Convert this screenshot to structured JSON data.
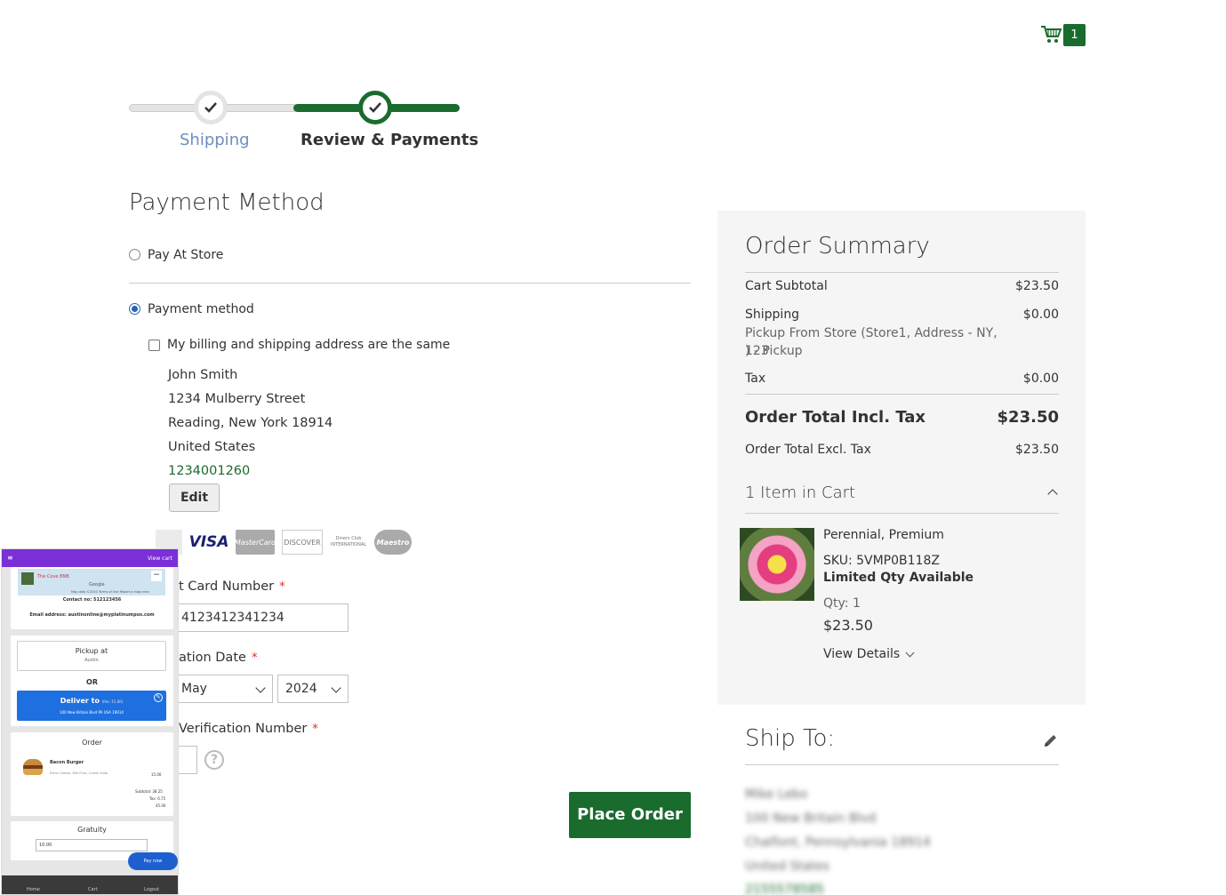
{
  "header": {
    "cart_count": "1"
  },
  "progress": {
    "steps": [
      {
        "label": "Shipping",
        "state": "complete"
      },
      {
        "label": "Review & Payments",
        "state": "active"
      }
    ]
  },
  "payment": {
    "title": "Payment Method",
    "options": [
      {
        "label": "Pay At Store",
        "selected": false
      },
      {
        "label": "Payment method",
        "selected": true
      }
    ],
    "same_address_label": "My billing and shipping address are the same",
    "address": {
      "name": "John Smith",
      "street": "1234 Mulberry Street",
      "city": "Reading, New York 18914",
      "country": "United States",
      "phone": "1234001260"
    },
    "edit_label": "Edit",
    "card_logos": [
      "VISA",
      "MasterCard",
      "DISCOVER",
      "Diners Club INTERNATIONAL",
      "Maestro"
    ],
    "card_number_label": "t Card Number",
    "card_number_value": "4123412341234",
    "expiration_label": "ation Date",
    "exp_month": "May",
    "exp_year": "2024",
    "cvv_label": "Verification Number",
    "required_mark": "*",
    "place_order": "Place Order"
  },
  "summary": {
    "title": "Order Summary",
    "cart_subtotal_label": "Cart Subtotal",
    "cart_subtotal_value": "$23.50",
    "shipping_label": "Shipping",
    "shipping_value": "$0.00",
    "shipping_method_line1": "Pickup From Store (Store1, Address - NY, 123",
    "shipping_method_line2": ") - Pickup",
    "tax_label": "Tax",
    "tax_value": "$0.00",
    "total_incl_label": "Order Total Incl. Tax",
    "total_incl_value": "$23.50",
    "total_excl_label": "Order Total Excl. Tax",
    "total_excl_value": "$23.50",
    "items_in_cart": "1 Item in Cart",
    "item": {
      "name": "Perennial, Premium",
      "sku": "SKU: 5VMP0B118Z",
      "stock": "Limited Qty Available",
      "qty": "Qty: 1",
      "price": "$23.50",
      "view_details": "View Details"
    }
  },
  "ship_to": {
    "title": "Ship To:",
    "lines": [
      "Mike Lebo",
      "100 New Britain Blvd",
      "Chalfont, Pennsylvania 18914",
      "United States",
      "2155578585"
    ]
  },
  "mobile": {
    "menu": "≡",
    "view_cart": "View cart",
    "map_label": "The Cove BNB",
    "google": "Google",
    "map_footer": "Map data ©2020  Terms of Use  Report a map error",
    "contact": "Contact no: 512123456",
    "email": "Email address: austinonline@myplatinumpos.com",
    "pickup_at": "Pickup at",
    "pickup_location": "Austin",
    "or": "OR",
    "deliver_to": "Deliver to",
    "deliver_fee": "(fee: 15.00)",
    "deliver_address": "100 New Britain Blvd PA USA 18914",
    "order_title": "Order",
    "order_item": "Bacon Burger",
    "order_item_desc": "Extra Cheese, Red Fries, Cream Soda",
    "order_item_price": "15.00",
    "subtotal": "Subtotal: 38.25",
    "tax": "Tax: 6.75",
    "total": "45.00",
    "gratuity_title": "Gratuity",
    "gratuity_value": "10.00",
    "pay_now": "Pay now",
    "nav": [
      "Home",
      "Cart",
      "Logout"
    ]
  }
}
